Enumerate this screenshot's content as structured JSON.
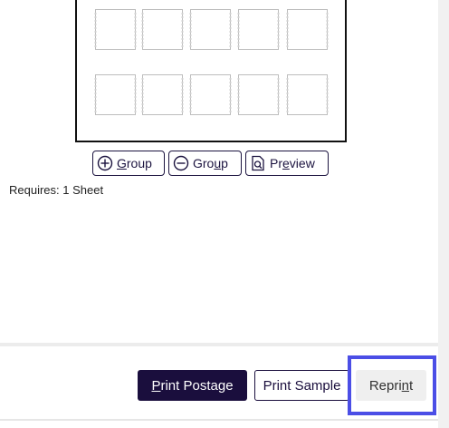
{
  "sheet": {
    "rows": 2,
    "cols": 5
  },
  "toolbar": {
    "add_group": {
      "icon": "plus-circle-icon",
      "label": "Group",
      "accel": "G"
    },
    "remove_group": {
      "icon": "minus-circle-icon",
      "label": "Group",
      "accel": "u"
    },
    "preview": {
      "icon": "preview-page-icon",
      "label": "Preview",
      "accel": "e"
    }
  },
  "requirements": {
    "label": "Requires:",
    "value": "1 Sheet"
  },
  "footer": {
    "print_postage": "Print Postage",
    "print_sample": "Print Sample",
    "reprint": "Reprint"
  },
  "colors": {
    "primary": "#1a0e3d",
    "highlight": "#4b4ee6",
    "reprint_bg": "#efefef"
  }
}
